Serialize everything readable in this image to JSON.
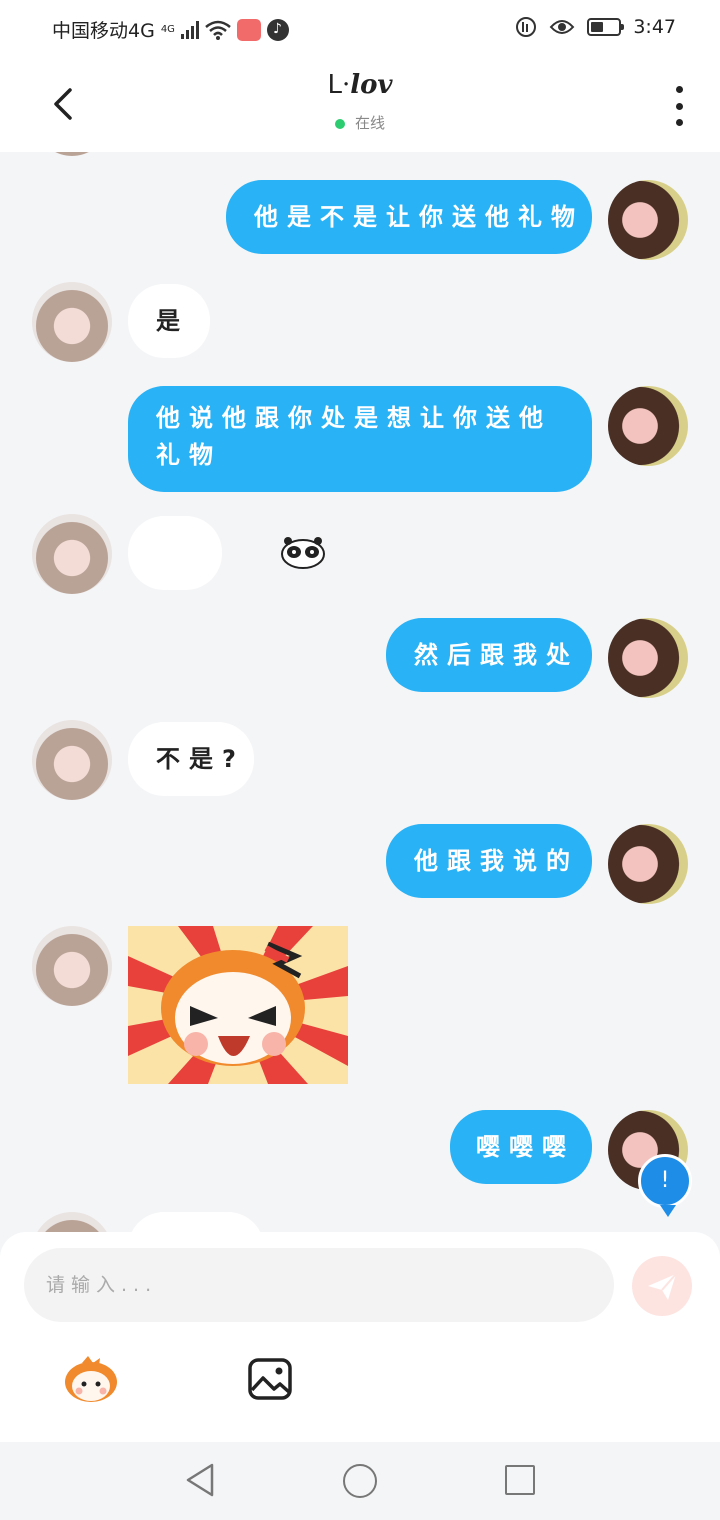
{
  "status_bar": {
    "carrier": "中国移动4G",
    "network_sup": "4G",
    "time": "3:47"
  },
  "header": {
    "logo": "lov",
    "status": "在线"
  },
  "messages": [
    {
      "from": "me",
      "text": "他是不是让你送他礼物"
    },
    {
      "from": "them",
      "text": "是"
    },
    {
      "from": "me",
      "text": "他说他跟你处是想让你送他礼物"
    },
    {
      "from": "them",
      "type": "sticker",
      "sticker": "panda-face-sticker"
    },
    {
      "from": "me",
      "text": "然后跟我处"
    },
    {
      "from": "them",
      "text": "不是?"
    },
    {
      "from": "me",
      "text": "他跟我说的"
    },
    {
      "from": "them",
      "type": "sticker",
      "sticker": "angry-cartoon-sticker"
    },
    {
      "from": "me",
      "text": "嘤嘤嘤"
    }
  ],
  "scroll_indicator": "!",
  "composer": {
    "placeholder": "请输入..."
  },
  "colors": {
    "my_bubble": "#29b2f5",
    "their_bubble": "#ffffff",
    "online_dot": "#2ecc71",
    "send_button": "#fde4e1"
  },
  "icons": [
    "back-arrow-icon",
    "more-options-icon",
    "send-icon",
    "emoji-sticker-icon",
    "image-icon",
    "wifi-icon",
    "eye-icon",
    "battery-icon"
  ]
}
